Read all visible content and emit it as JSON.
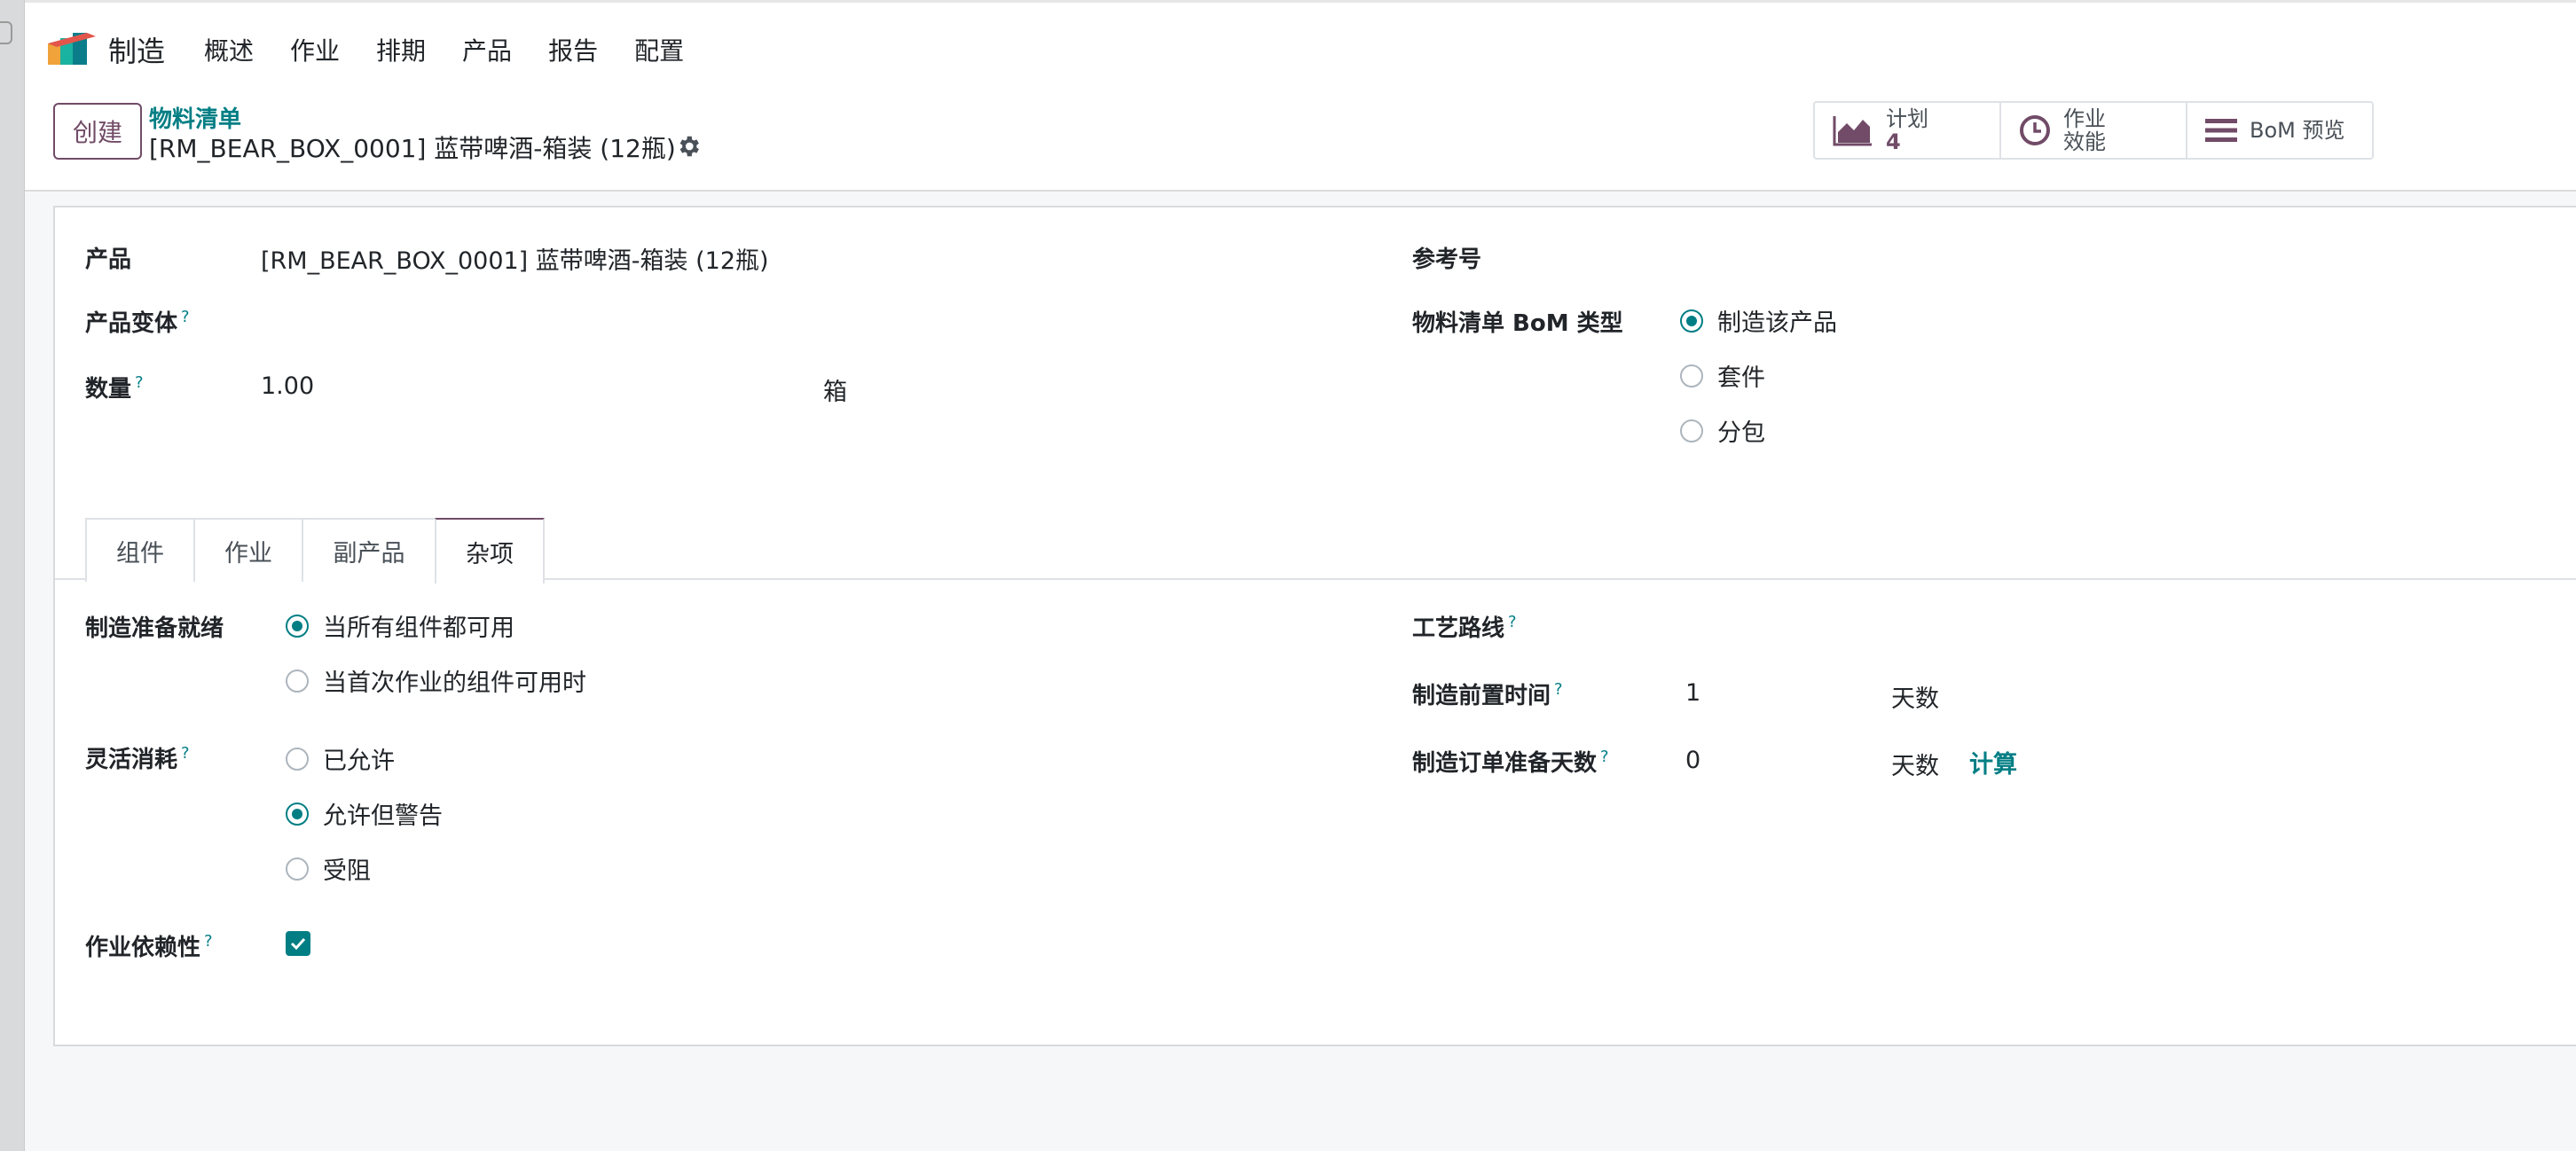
{
  "navbar": {
    "app_name": "制造",
    "menu": [
      "概述",
      "作业",
      "排期",
      "产品",
      "报告",
      "配置"
    ]
  },
  "control": {
    "create_label": "创建",
    "breadcrumb": "物料清单",
    "record_title": "[RM_BEAR_BOX_0001] 蓝带啤酒-箱装 (12瓶)",
    "smart_buttons": [
      {
        "icon": "area-chart-icon",
        "line1": "计划",
        "line2": "4"
      },
      {
        "icon": "clock-icon",
        "line1": "作业",
        "line2": "效能"
      },
      {
        "icon": "bars-icon",
        "line1": "BoM 预览",
        "line2": ""
      }
    ]
  },
  "form": {
    "product_label": "产品",
    "product_value": "[RM_BEAR_BOX_0001] 蓝带啤酒-箱装 (12瓶)",
    "variant_label": "产品变体",
    "qty_label": "数量",
    "qty_value": "1.00",
    "uom_value": "箱",
    "reference_label": "参考号",
    "bom_type_label": "物料清单 BoM 类型",
    "bom_types": [
      "制造该产品",
      "套件",
      "分包"
    ],
    "help_mark": "?"
  },
  "tabs": [
    "组件",
    "作业",
    "副产品",
    "杂项"
  ],
  "misc": {
    "ready_label": "制造准备就绪",
    "ready_options": [
      "当所有组件都可用",
      "当首次作业的组件可用时"
    ],
    "flex_label": "灵活消耗",
    "flex_options": [
      "已允许",
      "允许但警告",
      "受阻"
    ],
    "dependency_label": "作业依赖性",
    "routing_label": "工艺路线",
    "lead_label": "制造前置时间",
    "lead_value": "1",
    "lead_unit": "天数",
    "days_prepare_label": "制造订单准备天数",
    "days_prepare_value": "0",
    "days_prepare_unit": "天数",
    "compute_label": "计算"
  },
  "colors": {
    "brand": "#714b67",
    "accent": "#017e84"
  }
}
